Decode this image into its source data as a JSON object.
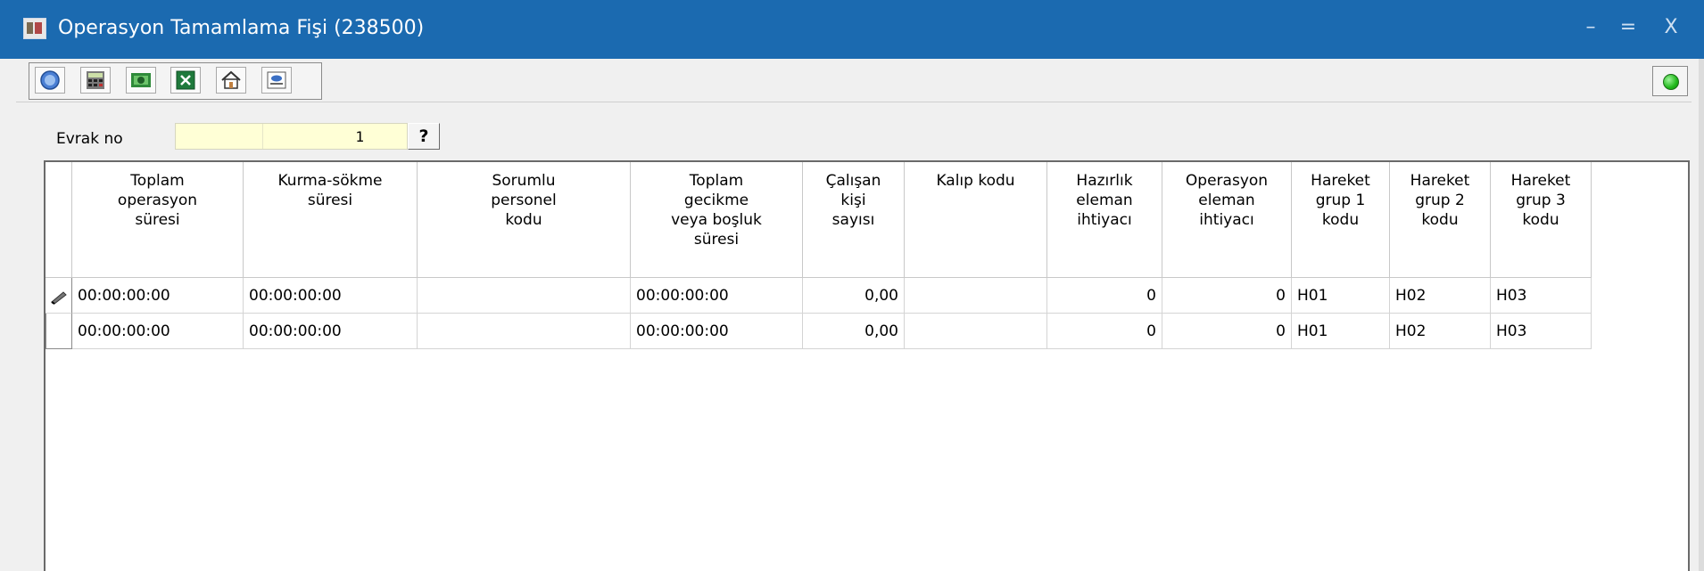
{
  "window": {
    "title": "Operasyon Tamamlama Fişi (238500)",
    "controls": {
      "minimize": "–",
      "maximize": "=",
      "close": "X"
    }
  },
  "toolbar": {
    "tools": [
      {
        "name": "help-icon"
      },
      {
        "name": "calculator-icon"
      },
      {
        "name": "money-icon"
      },
      {
        "name": "excel-icon"
      },
      {
        "name": "home-icon"
      },
      {
        "name": "print-preview-icon"
      }
    ],
    "status_color": "#1fb81a"
  },
  "form": {
    "evrak_label": "Evrak no",
    "evrak_value": "1",
    "lookup_label": "?"
  },
  "grid": {
    "columns": [
      "Toplam\noperasyon\nsüresi",
      "Kurma-sökme\nsüresi",
      "Sorumlu\npersonel\nkodu",
      "Toplam\ngecikme\nveya boşluk\nsüresi",
      "Çalışan\nkişi\nsayısı",
      "Kalıp kodu",
      "Hazırlık\neleman\nihtiyacı",
      "Operasyon\neleman\nihtiyacı",
      "Hareket\ngrup 1\nkodu",
      "Hareket\ngrup 2\nkodu",
      "Hareket\ngrup 3\nkodu"
    ],
    "rows": [
      [
        "00:00:00:00",
        "00:00:00:00",
        "",
        "00:00:00:00",
        "0,00",
        "",
        "0",
        "0",
        "H01",
        "H02",
        "H03"
      ],
      [
        "00:00:00:00",
        "00:00:00:00",
        "",
        "00:00:00:00",
        "0,00",
        "",
        "0",
        "0",
        "H01",
        "H02",
        "H03"
      ]
    ]
  }
}
